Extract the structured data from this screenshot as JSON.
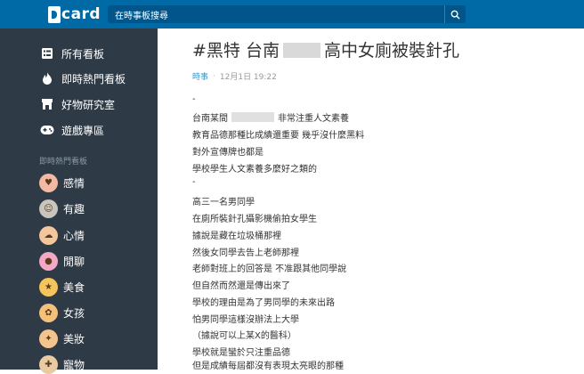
{
  "header": {
    "logo_text": "card",
    "search_placeholder": "在時事板搜尋"
  },
  "sidebar": {
    "nav": [
      {
        "icon": "boards-icon",
        "label": "所有看板"
      },
      {
        "icon": "fire-icon",
        "label": "即時熱門看板"
      },
      {
        "icon": "store-icon",
        "label": "好物研究室"
      },
      {
        "icon": "gamepad-icon",
        "label": "遊戲專區"
      }
    ],
    "section_title": "即時熱門看板",
    "boards": [
      {
        "label": "感情",
        "color": "#f3b9a3"
      },
      {
        "label": "有趣",
        "color": "#c9c4bd"
      },
      {
        "label": "心情",
        "color": "#f2c79e"
      },
      {
        "label": "閒聊",
        "color": "#f3a9c6"
      },
      {
        "label": "美食",
        "color": "#f5c45c"
      },
      {
        "label": "女孩",
        "color": "#f4c07a"
      },
      {
        "label": "美妝",
        "color": "#f3c48e"
      },
      {
        "label": "寵物",
        "color": "#e9cba3"
      }
    ]
  },
  "post": {
    "title_prefix": "#黑特 台南",
    "title_suffix": "高中女廁被裝針孔",
    "board": "時事",
    "date": "12月1日 19:22",
    "body": [
      {
        "text": "-"
      },
      {
        "text": "台南某間",
        "after": "非常注重人文素養",
        "redacted": true
      },
      {
        "text": "教育品德那種比成績還重要 幾乎沒什麼黑料"
      },
      {
        "text": "對外宣傳牌也都是"
      },
      {
        "text": "學校學生人文素養多麼好之類的"
      },
      {
        "text": "-"
      },
      {
        "text": "高三一名男同學"
      },
      {
        "text": "在廁所裝針孔攝影機偷拍女學生"
      },
      {
        "text": "據說是藏在垃圾桶那裡"
      },
      {
        "text": "然後女同學去告上老師那裡"
      },
      {
        "text": "老師對班上的回答是 不准跟其他同學說"
      },
      {
        "text": "但自然而然還是傳出來了"
      },
      {
        "text": "學校的理由是為了男同學的未來出路"
      },
      {
        "text": "怕男同學這樣沒辦法上大學"
      },
      {
        "text": "（據說可以上某X的醫科）"
      },
      {
        "text": "學校就是蠻於只注重品德"
      },
      {
        "text": "但是成績每屆都沒有表現太亮眼的那種"
      }
    ]
  }
}
